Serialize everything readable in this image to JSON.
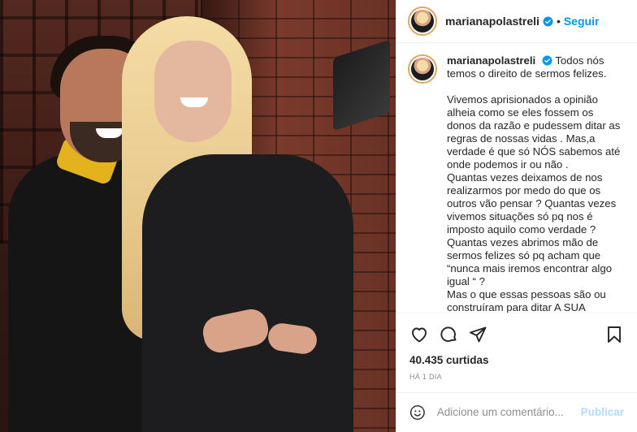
{
  "header": {
    "username": "marianapolastreli",
    "separator": "•",
    "follow_label": "Seguir"
  },
  "caption": {
    "username": "marianapolastreli",
    "first_line": "Todos nós temos o direito de sermos felizes.",
    "body": "Vivemos aprisionados a opinião alheia como se eles fossem os donos da razão e pudessem ditar as regras de nossas vidas . Mas,a verdade é que só NÓS sabemos até onde podemos ir ou não .\nQuantas vezes deixamos de nos realizarmos por medo do que os outros vão pensar ? Quantas vezes vivemos situações só pq nos é imposto aquilo como verdade ?\nQuantas vezes abrimos mão de sermos felizes só pq acham que “nunca mais iremos encontrar algo igual “ ?\nMas o que essas pessoas são ou construíram para ditar A SUA FELICIDADE ?"
  },
  "stats": {
    "likes": "40.435 curtidas",
    "time": "HÁ 1 DIA"
  },
  "comment": {
    "placeholder": "Adicione um comentário...",
    "publish_label": "Publicar"
  },
  "colors": {
    "accent": "#0095f6",
    "publish_disabled": "#b3dbff",
    "muted": "#8e8e8e"
  },
  "icons": [
    "verified-icon",
    "heart-icon",
    "comment-icon",
    "share-icon",
    "bookmark-icon",
    "emoji-icon"
  ]
}
